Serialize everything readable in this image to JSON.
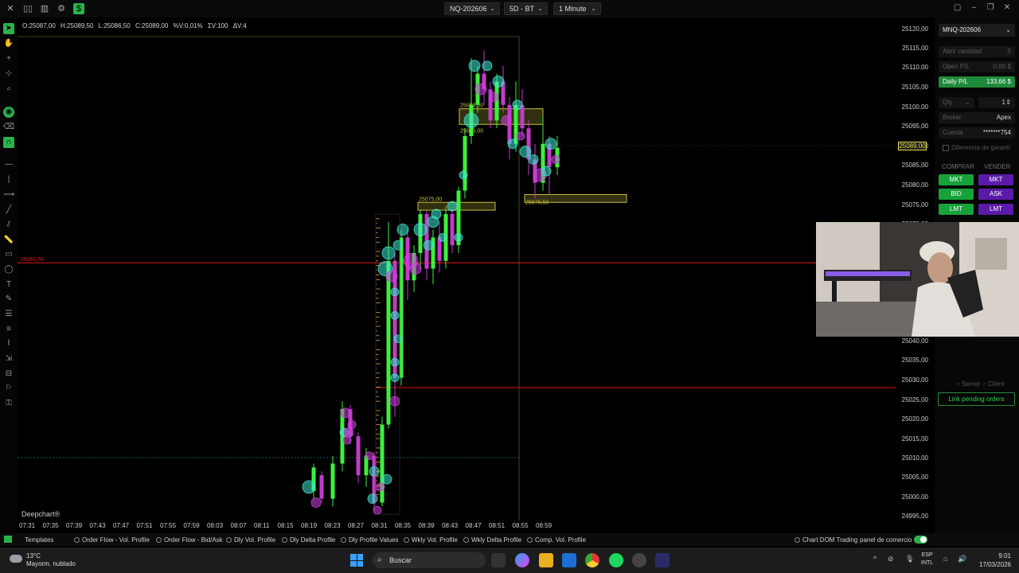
{
  "toolbar": {
    "symbol": "NQ-202606",
    "data_series": "5D - BT",
    "timeframe": "1 Minute"
  },
  "ohlc": {
    "open": "O:25087,00",
    "high": "H:25089,50",
    "low": "L:25086,50",
    "close": "C:25089,00",
    "pct": "%V:0,01%",
    "volume": "ΣV:100",
    "delta": "ΔV:4"
  },
  "chart": {
    "brand": "Deepchart®",
    "current_price": "25089,00",
    "level_labels": {
      "upper_box_top": "25099,50",
      "upper_box_bottom": "25095,00",
      "mid_box": "25075,00",
      "right_box": "25075,50",
      "red_line_left": "25060,50"
    },
    "price_ticks": [
      "25120,00",
      "25115,00",
      "25110,00",
      "25105,00",
      "25100,00",
      "25095,00",
      "25090,00",
      "25085,00",
      "25080,00",
      "25075,00",
      "25070,00",
      "25040,00",
      "25035,00",
      "25030,00",
      "25025,00",
      "25020,00",
      "25015,00",
      "25010,00",
      "25005,00",
      "25000,00",
      "24995,00"
    ],
    "time_ticks": [
      "07:31",
      "07:35",
      "07:39",
      "07:43",
      "07:47",
      "07:51",
      "07:55",
      "07:59",
      "08:03",
      "08:07",
      "08:11",
      "08:15",
      "08:19",
      "08:23",
      "08:27",
      "08:31",
      "08:35",
      "08:39",
      "08:43",
      "08:47",
      "08:51",
      "08:55",
      "08:59"
    ]
  },
  "chart_data": {
    "type": "candlestick",
    "title": "",
    "xlabel": "",
    "ylabel": "",
    "ylim": [
      24993,
      25122
    ],
    "note": "1-minute NQ-202606 candles with order-flow bubbles",
    "horizontal_lines": [
      25059.5,
      25027.5
    ],
    "boxes": [
      {
        "label": "25099,50",
        "low": 25095,
        "high": 25099
      },
      {
        "label": "25075,00",
        "low": 25073,
        "high": 25075
      },
      {
        "label": "25075,50",
        "low": 25075,
        "high": 25077
      }
    ]
  },
  "right_panel": {
    "account_symbol": "MNQ-202606",
    "open_qty_label": "Abrir cantidad",
    "open_qty_value": "0",
    "open_pl_label": "Open P/L",
    "open_pl_value": "-0,00 $",
    "daily_pl_label": "Daily P/L",
    "daily_pl_value": "133,66 $",
    "qty_label": "Qty",
    "qty_value": "1",
    "broker_label": "Broker",
    "broker_value": "Apex",
    "account_label": "Cuenta",
    "account_value": "*******754",
    "guarantee_label": "Diferencia de garantí",
    "buy_header": "COMPRAR",
    "sell_header": "VENDER",
    "buy_buttons": [
      "MKT",
      "BID",
      "LMT"
    ],
    "sell_buttons": [
      "MKT",
      "ASK",
      "LMT"
    ],
    "server_label": "Server",
    "client_label": "Client",
    "link_pending": "Link pending orders"
  },
  "tabs": {
    "templates": "Templates",
    "items": [
      "Order Flow - Vol. Profile",
      "Order Flow - Bid/Ask",
      "Dly Vol. Profile",
      "Dly Delta Profile",
      "Dly Profile Values",
      "Wkly Vol. Profile",
      "Wkly Delta Profile",
      "Comp. Vol. Profile"
    ],
    "chart_dom": "Chart DOM Trading",
    "panel": "panel de comercio"
  },
  "taskbar": {
    "temp": "13°C",
    "weather": "Mayorm. nublado",
    "search_placeholder": "Buscar",
    "lang1": "ESP",
    "lang2": "INTL",
    "time": "9:01",
    "date": "17/03/2026"
  },
  "colors": {
    "bull": "#3cf03c",
    "bear": "#c23cc8",
    "bubble_cyan": "#3de8d0",
    "bubble_magenta": "#d040e0",
    "level_red": "#e01818",
    "box_yellow": "#c8c040",
    "accent_green": "#2bb34a"
  }
}
